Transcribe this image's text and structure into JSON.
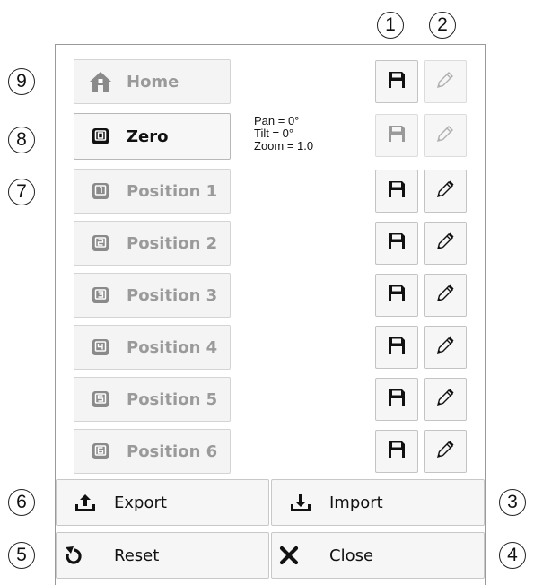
{
  "callouts": [
    "1",
    "2",
    "3",
    "4",
    "5",
    "6",
    "7",
    "8",
    "9"
  ],
  "positions": [
    {
      "label": "Home",
      "icon": "home-icon",
      "active": false
    },
    {
      "label": "Zero",
      "icon": "key-0-icon",
      "digit": "0",
      "active": true
    },
    {
      "label": "Position 1",
      "icon": "key-1-icon",
      "digit": "1",
      "active": false
    },
    {
      "label": "Position 2",
      "icon": "key-2-icon",
      "digit": "2",
      "active": false
    },
    {
      "label": "Position 3",
      "icon": "key-3-icon",
      "digit": "3",
      "active": false
    },
    {
      "label": "Position 4",
      "icon": "key-4-icon",
      "digit": "4",
      "active": false
    },
    {
      "label": "Position 5",
      "icon": "key-5-icon",
      "digit": "5",
      "active": false
    },
    {
      "label": "Position 6",
      "icon": "key-6-icon",
      "digit": "6",
      "active": false
    }
  ],
  "info": {
    "pan": "Pan =  0°",
    "tilt": "Tilt =  0°",
    "zoom": "Zoom =  1.0"
  },
  "actions": {
    "export": "Export",
    "import": "Import",
    "reset": "Reset",
    "close": "Close"
  },
  "colors": {
    "active_text": "#111111",
    "inactive_text": "#9a9a9a",
    "button_bg": "#f4f4f4",
    "border": "#c4c4c4"
  }
}
